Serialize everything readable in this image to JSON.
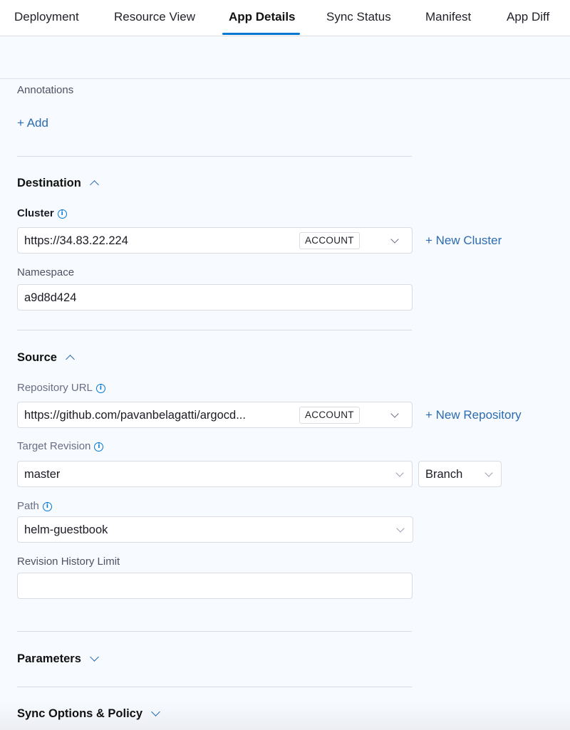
{
  "tabs": [
    {
      "label": "Deployment",
      "active": false
    },
    {
      "label": "Resource View",
      "active": false
    },
    {
      "label": "App Details",
      "active": true
    },
    {
      "label": "Sync Status",
      "active": false
    },
    {
      "label": "Manifest",
      "active": false
    },
    {
      "label": "App Diff",
      "active": false
    }
  ],
  "annotations": {
    "label": "Annotations",
    "add_link": "+ Add"
  },
  "destination": {
    "title": "Destination",
    "cluster_label": "Cluster",
    "cluster_value": "https://34.83.22.224",
    "cluster_badge": "ACCOUNT",
    "new_cluster_link": "+ New Cluster",
    "namespace_label": "Namespace",
    "namespace_value": "a9d8d424"
  },
  "source": {
    "title": "Source",
    "repo_label": "Repository URL",
    "repo_value": "https://github.com/pavanbelagatti/argocd...",
    "repo_badge": "ACCOUNT",
    "new_repo_link": "+ New Repository",
    "revision_label": "Target Revision",
    "revision_value": "master",
    "revision_type": "Branch",
    "path_label": "Path",
    "path_value": "helm-guestbook",
    "history_label": "Revision History Limit",
    "history_value": ""
  },
  "parameters": {
    "title": "Parameters"
  },
  "sync_options": {
    "title": "Sync Options & Policy"
  },
  "icons": {
    "info": "info-circle-icon",
    "collapse": "chevron-up-icon",
    "expand": "chevron-down-icon",
    "dropdown": "chevron-down-icon"
  },
  "colors": {
    "accent": "#0278d5",
    "link": "#2b6cb0",
    "background": "#f7fafe"
  }
}
